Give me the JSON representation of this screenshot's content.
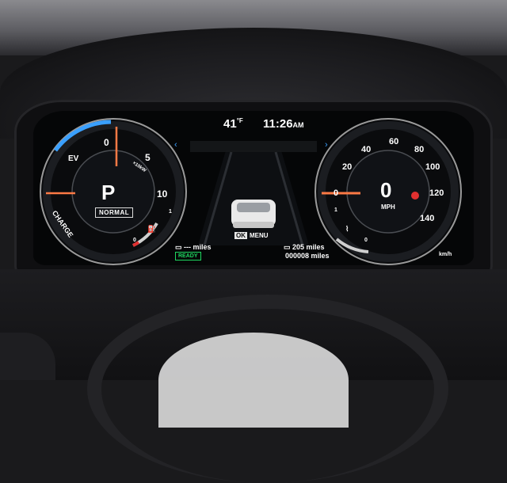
{
  "status_bar": {
    "outside_temp": "41",
    "temp_unit": "°F",
    "time": "11:26",
    "ampm": "AM"
  },
  "left_gauge": {
    "type": "power-meter",
    "zone_labels": [
      "EV",
      "CHARGE"
    ],
    "ticks": [
      "0",
      "5",
      "10"
    ],
    "power_label": "×10kW",
    "needle_reading": "0",
    "gear": "P",
    "drive_mode": "NORMAL",
    "fuel_scale": [
      "1",
      "0"
    ]
  },
  "right_gauge": {
    "type": "speedometer",
    "ticks": [
      "0",
      "20",
      "40",
      "60",
      "80",
      "100",
      "120",
      "140"
    ],
    "speed": "0",
    "speed_unit": "MPH",
    "kmh_label": "km/h",
    "temp_scale": [
      "1",
      "0"
    ]
  },
  "center": {
    "menu_ok": "OK",
    "menu_label": "MENU"
  },
  "trip": {
    "ev_range": "--- miles",
    "status": "READY",
    "fuel_range": "205 miles",
    "odometer": "000008 miles"
  },
  "colors": {
    "ev_accent": "#3aa0ff",
    "needle": "#ff7a45",
    "ready_green": "#1ed760",
    "warning": "#e03030"
  }
}
